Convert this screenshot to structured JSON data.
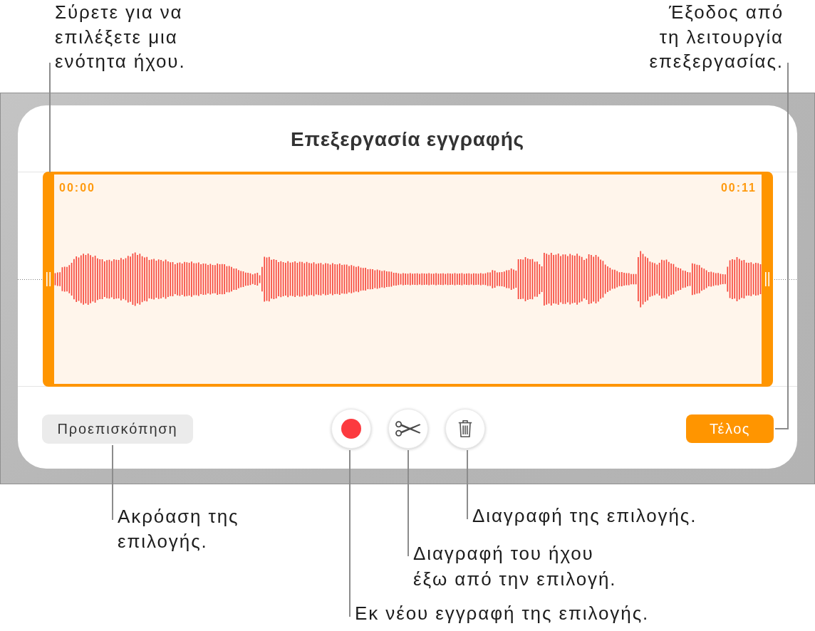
{
  "callouts": [
    {
      "lines": [
        "Σύρετε για να",
        "επιλέξετε μια",
        "ενότητα ήχου."
      ]
    },
    {
      "lines": [
        "Έξοδος από",
        "τη λειτουργία",
        "επεξεργασίας."
      ]
    },
    {
      "lines": [
        "Ακρόαση της",
        "επιλογής."
      ]
    },
    {
      "lines": [
        "Διαγραφή της επιλογής."
      ]
    },
    {
      "lines": [
        "Διαγραφή του ήχου",
        "έξω από την επιλογή."
      ]
    },
    {
      "lines": [
        "Εκ νέου εγγραφή της επιλογής."
      ]
    }
  ],
  "dialog": {
    "title": "Επεξεργασία εγγραφής",
    "selection": {
      "start_time": "00:00",
      "end_time": "00:11"
    },
    "preview_button": {
      "label": "Προεπισκόπηση"
    },
    "tool_buttons": [
      {
        "kind": "record"
      },
      {
        "kind": "trim"
      },
      {
        "kind": "delete"
      }
    ],
    "done_button": {
      "label": "Τέλος"
    }
  }
}
